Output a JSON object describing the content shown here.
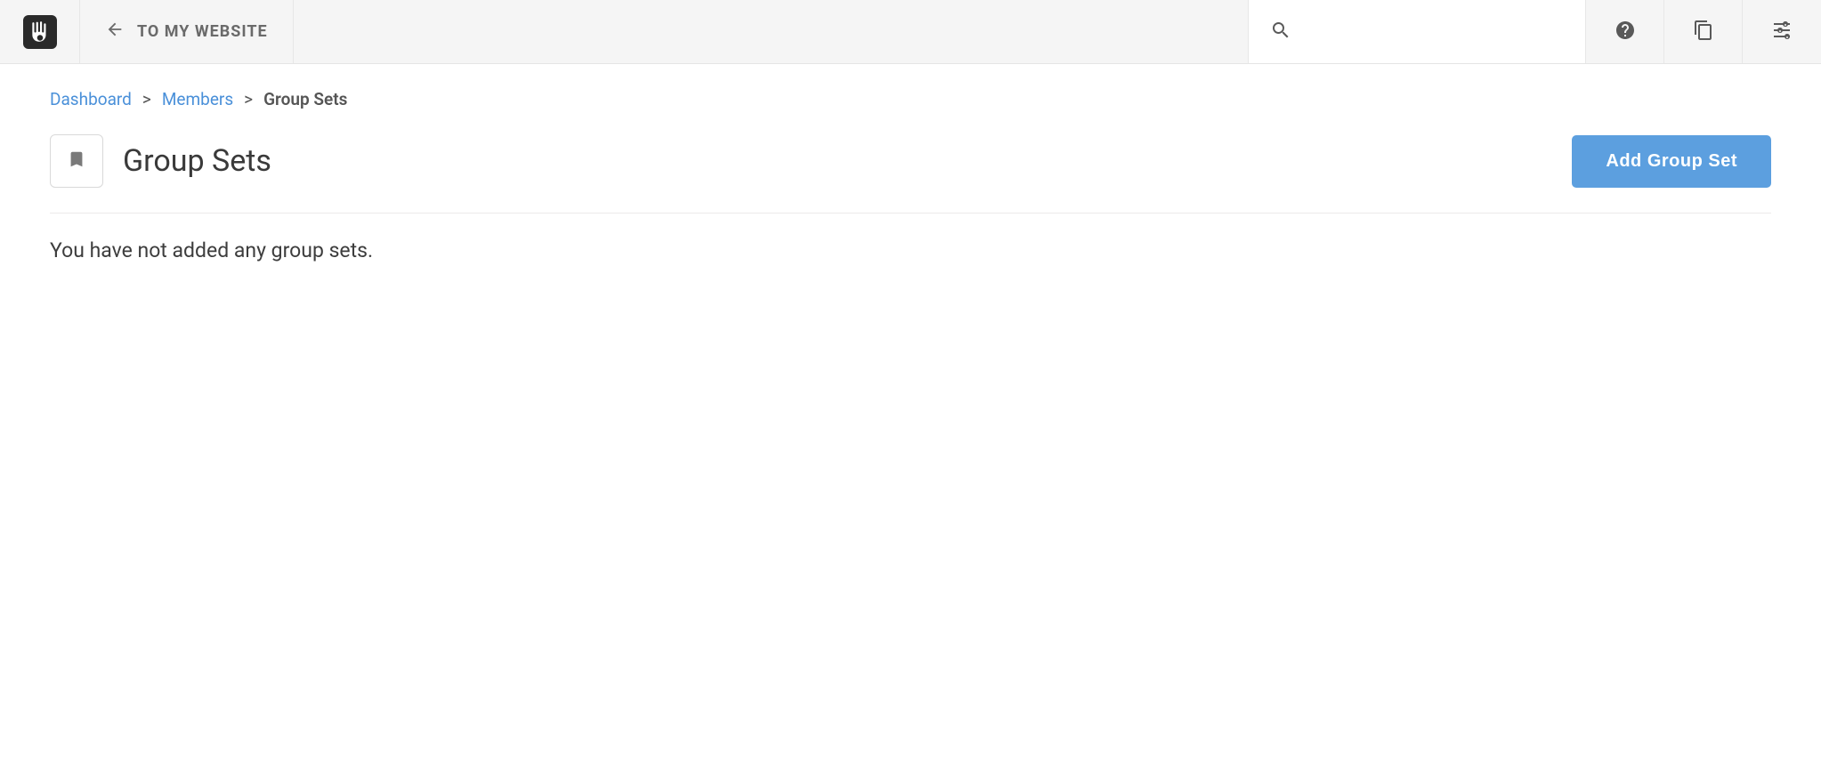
{
  "toolbar": {
    "back_label": "TO MY WEBSITE",
    "search_placeholder": ""
  },
  "breadcrumb": {
    "items": [
      {
        "label": "Dashboard"
      },
      {
        "label": "Members"
      }
    ],
    "current": "Group Sets",
    "separator": ">"
  },
  "page": {
    "title": "Group Sets",
    "add_button_label": "Add Group Set",
    "empty_message": "You have not added any group sets."
  }
}
